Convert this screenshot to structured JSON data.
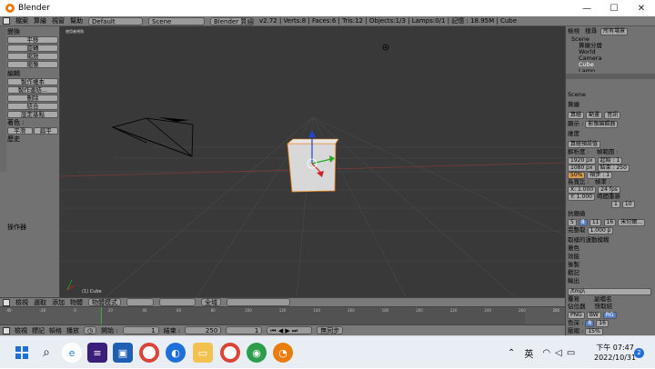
{
  "window": {
    "title": "Blender"
  },
  "menu": {
    "items": [
      "檔案",
      "算繪",
      "視窗",
      "幫助"
    ],
    "layout": "Default",
    "scene": "Scene",
    "engine": "Blender 算繪",
    "stats": "v2.72 | Verts:8 | Faces:6 | Tris:12 | Objects:1/3 | Lamps:0/1 | 記憶 : 18.95M | Cube"
  },
  "left": {
    "transform_header": "變換",
    "transform_buttons": [
      "平移",
      "旋轉",
      "縮放",
      "縮像"
    ],
    "edit_header": "編輯",
    "edit_buttons": [
      "製作複本",
      "製作連結...",
      "刪除",
      "結合",
      "設定基點"
    ],
    "shading_label": "著色 :",
    "shading_buttons": [
      "平滑",
      "扁平"
    ],
    "history": "歷史",
    "operator": "操作器"
  },
  "viewport": {
    "mode_label": "使用者視角",
    "object_label": "(1) Cube"
  },
  "outliner": {
    "menu": [
      "檢視",
      "搜尋",
      "所有場景"
    ],
    "items": [
      "Scene",
      "算繪分層",
      "World",
      "Camera",
      "Cube",
      "Lamp"
    ]
  },
  "properties": {
    "scene": "Scene",
    "render_header": "算繪",
    "render_buttons": [
      "算繪",
      "動畫",
      "音訊"
    ],
    "display_label": "顯示 :",
    "display_value": "影像編輯器",
    "dimensions_header": "維度",
    "preset": "算繪預設值",
    "resolution_label": "解析度 :",
    "frame_range_label": "幀範圍 :",
    "res_x": "1920 px",
    "res_y": "1080 px",
    "res_pct": "50%",
    "start": "起始 : 1",
    "end": "結束 : 250",
    "step": "幀步 : 1",
    "aspect_label": "長寬比 :",
    "fps_label": "幀率 :",
    "aspect_x": "X: 1.000",
    "aspect_y": "Y: 1.000",
    "fps": "24 fps",
    "remap_label": "時間重新",
    "remap_old": "1",
    "remap_new": "10",
    "aa_header": "抗鋸齒",
    "aa_values": [
      "5",
      "8",
      "11",
      "16"
    ],
    "aa_filter": "米切爾...",
    "full_sample": "完整取",
    "aa_size": "1.000 p",
    "motion_blur": "取樣的運動模糊",
    "shading": "著色",
    "performance": "效能",
    "post": "後製",
    "stamp": "戳記",
    "output_header": "輸出",
    "output_path": "/tmp\\",
    "overwrite": "覆寫",
    "file_ext": "副檔名",
    "placeholders": "佔位器",
    "cache": "快取結",
    "format": "PNG",
    "color_modes": [
      "BW",
      "RG"
    ],
    "color_depth_label": "色深 :",
    "color_depth_values": [
      "8",
      "16"
    ],
    "compression_label": "壓縮 :",
    "compression": "15%"
  },
  "view_header": {
    "items": [
      "檢視",
      "選取",
      "添加",
      "物體"
    ],
    "mode": "物體模式",
    "global": "全域"
  },
  "timeline": {
    "ruler": [
      "-40",
      "-20",
      "0",
      "20",
      "40",
      "60",
      "80",
      "100",
      "120",
      "140",
      "160",
      "180",
      "200",
      "220",
      "240",
      "260",
      "280"
    ],
    "menu": [
      "檢視",
      "標記",
      "幀格",
      "播放"
    ],
    "start": "開始 :",
    "start_val": "1",
    "end": "結束 :",
    "end_val": "250",
    "current": "1",
    "sync": "無同步"
  },
  "taskbar": {
    "lang": "英",
    "time": "下午 07:47",
    "date": "2022/10/31",
    "notif": "2"
  },
  "colors": {
    "accent": "#e87d0d",
    "viewport": "#393939",
    "panel": "#727272",
    "selected": "#5680c2"
  }
}
